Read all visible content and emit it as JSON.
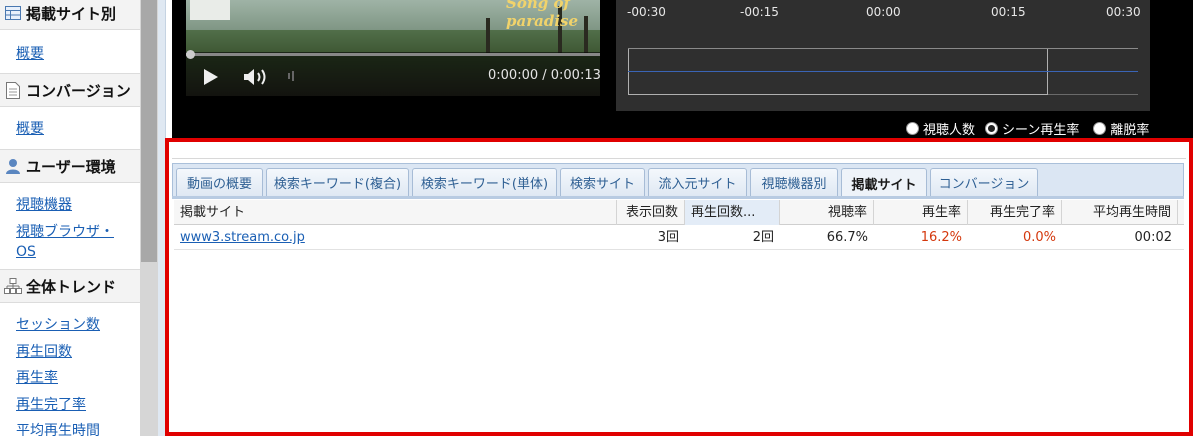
{
  "sidebar": {
    "sections": [
      {
        "title": "掲載サイト別",
        "icon": "table-icon",
        "links": [
          "概要"
        ]
      },
      {
        "title": "コンバージョン",
        "icon": "document-icon",
        "links": [
          "概要"
        ]
      },
      {
        "title": "ユーザー環境",
        "icon": "user-icon",
        "links": [
          "視聴機器",
          "視聴ブラウザ・",
          "OS"
        ]
      },
      {
        "title": "全体トレンド",
        "icon": "sitemap-icon",
        "links": [
          "セッション数",
          "再生回数",
          "再生率",
          "再生完了率",
          "平均再生時間"
        ]
      }
    ]
  },
  "player": {
    "title_overlay": "Song of paradise",
    "time": "0:00:00 / 0:00:13"
  },
  "graph": {
    "ticks": [
      "-00:30",
      "-00:15",
      "00:00",
      "00:15",
      "00:30"
    ]
  },
  "radios": [
    {
      "label": "視聴人数",
      "selected": false
    },
    {
      "label": "シーン再生率",
      "selected": true
    },
    {
      "label": "離脱率",
      "selected": false
    }
  ],
  "tabs": [
    {
      "label": "動画の概要",
      "active": false
    },
    {
      "label": "検索キーワード(複合)",
      "active": false
    },
    {
      "label": "検索キーワード(単体)",
      "active": false
    },
    {
      "label": "検索サイト",
      "active": false
    },
    {
      "label": "流入元サイト",
      "active": false
    },
    {
      "label": "視聴機器別",
      "active": false
    },
    {
      "label": "掲載サイト",
      "active": true
    },
    {
      "label": "コンバージョン",
      "active": false
    }
  ],
  "table": {
    "columns": [
      "掲載サイト",
      "表示回数",
      "再生回数...",
      "視聴率",
      "再生率",
      "再生完了率",
      "平均再生時間"
    ],
    "rows": [
      [
        "www3.stream.co.jp",
        "3回",
        "2回",
        "66.7%",
        "16.2%",
        "0.0%",
        "00:02"
      ]
    ]
  },
  "colors": {
    "highlight": "#e00000",
    "link": "#1a5fb4",
    "accent_red": "#d4380d"
  }
}
